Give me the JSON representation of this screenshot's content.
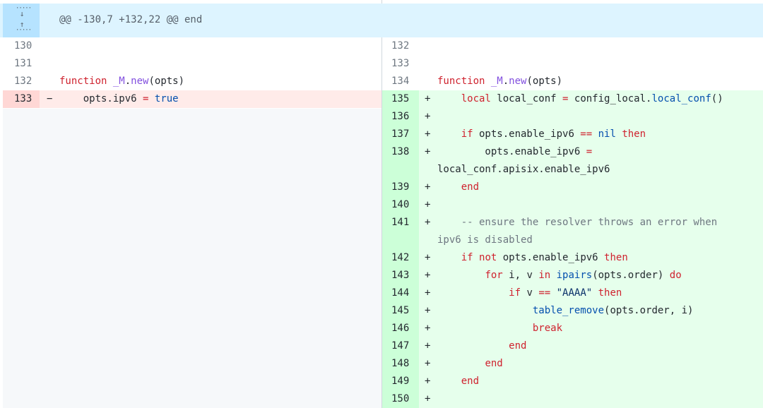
{
  "hunk": {
    "header": "@@ -130,7 +132,22 @@ end",
    "expand_down_icon": "arrow-down-dotted-icon",
    "expand_up_icon": "arrow-up-dotted-icon"
  },
  "left": {
    "lines": [
      {
        "num": "130",
        "sign": "",
        "type": "context",
        "text": ""
      },
      {
        "num": "131",
        "sign": "",
        "type": "context",
        "text": ""
      },
      {
        "num": "132",
        "sign": "",
        "type": "context",
        "text": "function _M.new(opts)"
      },
      {
        "num": "133",
        "sign": "−",
        "type": "del",
        "text": "    opts.ipv6 = true"
      }
    ]
  },
  "right": {
    "lines": [
      {
        "num": "132",
        "sign": "",
        "type": "context",
        "text": ""
      },
      {
        "num": "133",
        "sign": "",
        "type": "context",
        "text": ""
      },
      {
        "num": "134",
        "sign": "",
        "type": "context",
        "text": "function _M.new(opts)"
      },
      {
        "num": "135",
        "sign": "+",
        "type": "add",
        "text": "    local local_conf = config_local.local_conf()"
      },
      {
        "num": "136",
        "sign": "+",
        "type": "add",
        "text": ""
      },
      {
        "num": "137",
        "sign": "+",
        "type": "add",
        "text": "    if opts.enable_ipv6 == nil then"
      },
      {
        "num": "138",
        "sign": "+",
        "type": "add",
        "text": "        opts.enable_ipv6 =",
        "cont": "local_conf.apisix.enable_ipv6"
      },
      {
        "num": "139",
        "sign": "+",
        "type": "add",
        "text": "    end"
      },
      {
        "num": "140",
        "sign": "+",
        "type": "add",
        "text": ""
      },
      {
        "num": "141",
        "sign": "+",
        "type": "add",
        "text": "    -- ensure the resolver throws an error when",
        "cont": "ipv6 is disabled"
      },
      {
        "num": "142",
        "sign": "+",
        "type": "add",
        "text": "    if not opts.enable_ipv6 then"
      },
      {
        "num": "143",
        "sign": "+",
        "type": "add",
        "text": "        for i, v in ipairs(opts.order) do"
      },
      {
        "num": "144",
        "sign": "+",
        "type": "add",
        "text": "            if v == \"AAAA\" then"
      },
      {
        "num": "145",
        "sign": "+",
        "type": "add",
        "text": "                table_remove(opts.order, i)"
      },
      {
        "num": "146",
        "sign": "+",
        "type": "add",
        "text": "                break"
      },
      {
        "num": "147",
        "sign": "+",
        "type": "add",
        "text": "            end"
      },
      {
        "num": "148",
        "sign": "+",
        "type": "add",
        "text": "        end"
      },
      {
        "num": "149",
        "sign": "+",
        "type": "add",
        "text": "    end"
      },
      {
        "num": "150",
        "sign": "+",
        "type": "add",
        "text": ""
      }
    ]
  },
  "colors": {
    "hunk_bg": "#ddf4ff",
    "add_bg": "#e6ffec",
    "add_num_bg": "#ccffd8",
    "del_bg": "#ffebe9",
    "del_num_bg": "#ffd7d5",
    "keyword": "#cf222e",
    "function": "#8250df",
    "constant": "#0550ae",
    "string": "#0a3069",
    "comment": "#6e7781"
  }
}
